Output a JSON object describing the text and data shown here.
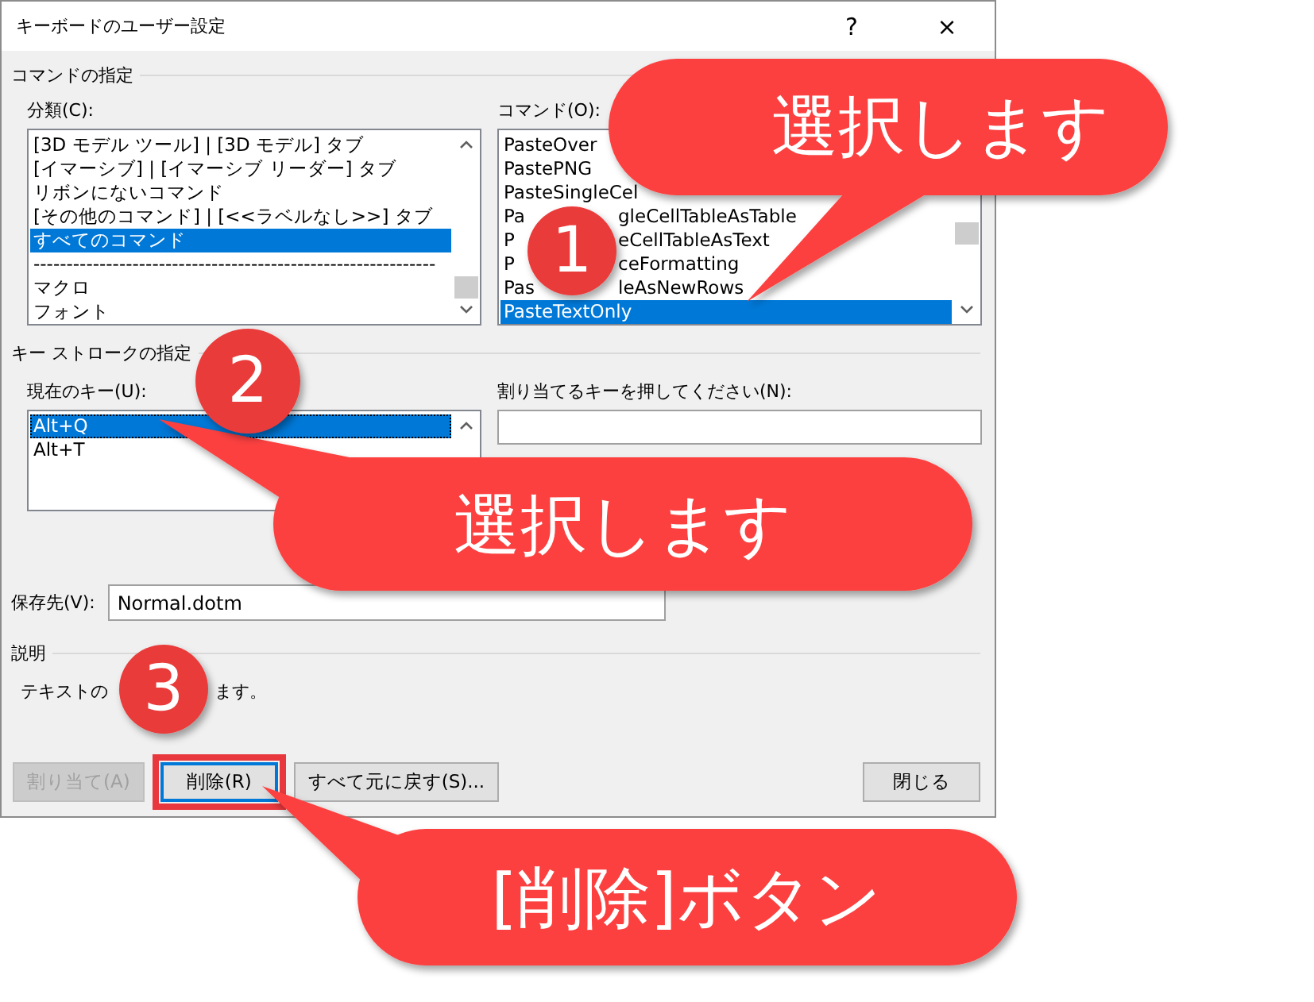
{
  "window": {
    "title": "キーボードのユーザー設定",
    "help": "?",
    "close": "×"
  },
  "command_section": {
    "title": "コマンドの指定",
    "categories": {
      "label": "分類(C):",
      "items": [
        {
          "text": "[3D モデル ツール] | [3D モデル] タブ",
          "selected": false
        },
        {
          "text": "[イマーシブ] | [イマーシブ リーダー] タブ",
          "selected": false
        },
        {
          "text": "リボンにないコマンド",
          "selected": false
        },
        {
          "text": "[その他のコマンド] | [<<ラベルなし>>] タブ",
          "selected": false
        },
        {
          "text": "すべてのコマンド",
          "selected": true
        },
        {
          "text": "-------------------------------------------------------------",
          "selected": false
        },
        {
          "text": "マクロ",
          "selected": false
        },
        {
          "text": "フォント",
          "selected": false
        }
      ]
    },
    "commands": {
      "label": "コマンド(O):",
      "items": [
        {
          "parts": [
            "PasteOver"
          ],
          "selected": false
        },
        {
          "parts": [
            "PastePNG"
          ],
          "selected": false
        },
        {
          "parts": [
            "PasteSingleCel"
          ],
          "selected": false
        },
        {
          "parts": [
            "Pa",
            "gleCellTableAsTable"
          ],
          "selected": false
        },
        {
          "parts": [
            "P",
            "eCellTableAsText"
          ],
          "selected": false
        },
        {
          "parts": [
            "P",
            "ceFormatting"
          ],
          "selected": false
        },
        {
          "parts": [
            "Pas",
            "leAsNewRows"
          ],
          "selected": false
        },
        {
          "parts": [
            "PasteTextOnly"
          ],
          "selected": true
        }
      ]
    }
  },
  "keystroke_section": {
    "title": "キー ストロークの指定",
    "current_keys": {
      "label": "現在のキー(U):",
      "items": [
        {
          "text": "Alt+Q",
          "selected": true
        },
        {
          "text": "Alt+T",
          "selected": false
        }
      ]
    },
    "new_key": {
      "label": "割り当てるキーを押してください(N):"
    }
  },
  "save_in": {
    "label": "保存先(V):",
    "value": "Normal.dotm"
  },
  "description": {
    "title": "説明",
    "parts": [
      "テキストの",
      "ます。"
    ]
  },
  "buttons": [
    {
      "label": "割り当て(A)",
      "disabled": true,
      "focused": false,
      "highlighted": false
    },
    {
      "label": "削除(R)",
      "disabled": false,
      "focused": true,
      "highlighted": true
    },
    {
      "label": "すべて元に戻す(S)...",
      "disabled": false,
      "focused": false,
      "highlighted": false
    },
    {
      "label": "閉じる",
      "disabled": false,
      "focused": false,
      "highlighted": false
    }
  ],
  "annotations": {
    "callouts": [
      "選択します",
      "選択します",
      "[削除]ボタン"
    ],
    "steps": [
      "1",
      "2",
      "3"
    ]
  }
}
